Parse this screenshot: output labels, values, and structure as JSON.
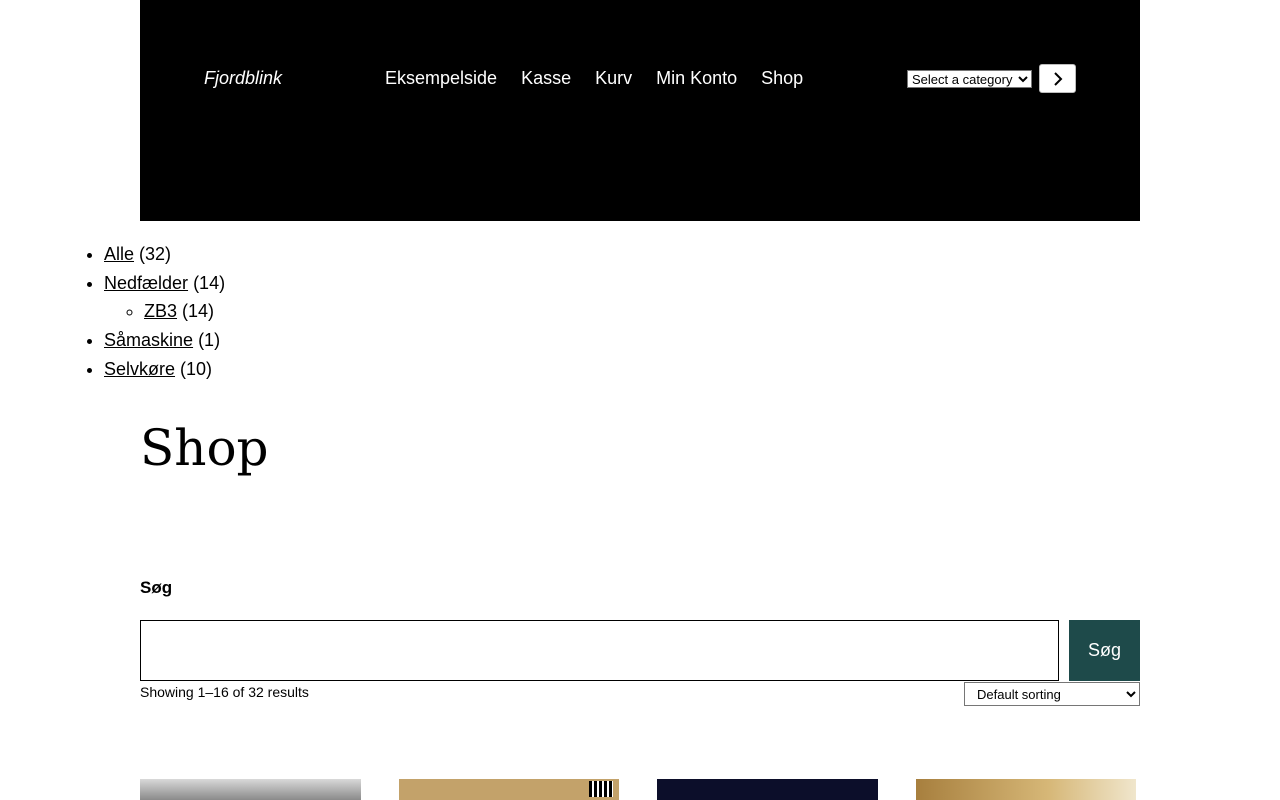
{
  "header": {
    "site_title": "Fjordblink",
    "nav": [
      "Eksempelside",
      "Kasse",
      "Kurv",
      "Min Konto",
      "Shop"
    ],
    "category_select": "Select a category"
  },
  "categories": [
    {
      "label": "Alle",
      "count": "(32)"
    },
    {
      "label": "Nedfælder",
      "count": "(14)"
    },
    {
      "label": "ZB3",
      "count": "(14)"
    },
    {
      "label": "Såmaskine",
      "count": "(1)"
    },
    {
      "label": "Selvkøre",
      "count": "(10)"
    }
  ],
  "main": {
    "title": "Shop",
    "search_label": "Søg",
    "search_value": "",
    "search_button": "Søg",
    "result_count": "Showing 1–16 of 32 results",
    "sort_selected": "Default sorting"
  },
  "colors": {
    "header_bg": "#000000",
    "search_button_bg": "#1e4a4a"
  }
}
